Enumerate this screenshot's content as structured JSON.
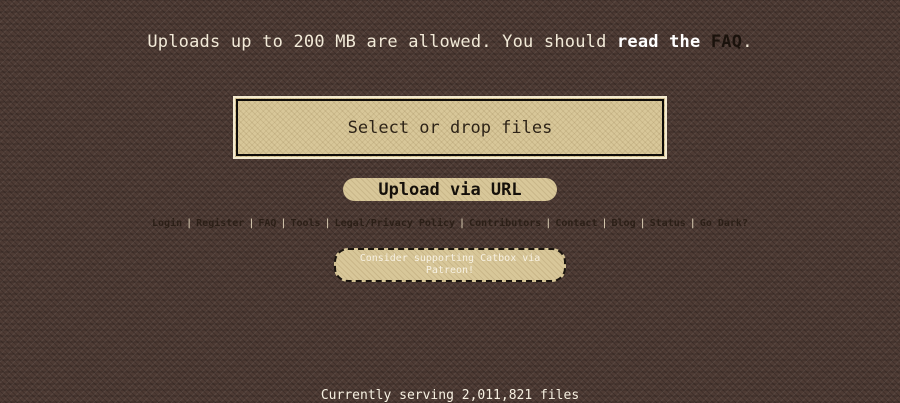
{
  "notice": {
    "prefix": "Uploads up to 200 MB are allowed. You should ",
    "read_the": "read the",
    "faq_link": "FAQ",
    "suffix": "."
  },
  "dropzone": {
    "label": "Select or drop files"
  },
  "url_upload": {
    "label": "Upload via URL"
  },
  "nav": {
    "items": [
      {
        "label": "Login"
      },
      {
        "label": "Register"
      },
      {
        "label": "FAQ"
      },
      {
        "label": "Tools"
      },
      {
        "label": "Legal/Privacy Policy"
      },
      {
        "label": "Contributors"
      },
      {
        "label": "Contact"
      },
      {
        "label": "Blog"
      },
      {
        "label": "Status"
      },
      {
        "label": "Go Dark?"
      }
    ],
    "separator": "|"
  },
  "patreon": {
    "text": "Consider supporting Catbox via Patreon!"
  },
  "footer": {
    "serving_text": "Currently serving 2,011,821 files"
  },
  "colors": {
    "background": "#4e3b34",
    "panel": "#d8c799",
    "text_light": "#f2ead8",
    "text_dark": "#15100a"
  }
}
